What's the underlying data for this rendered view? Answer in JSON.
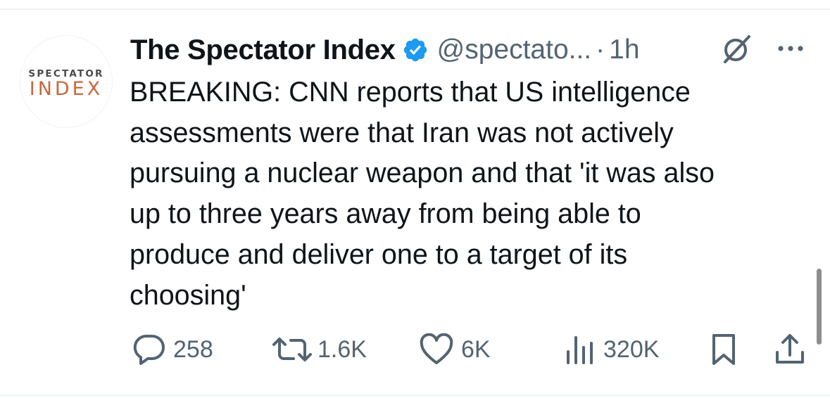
{
  "avatar": {
    "line1": "SPECTATOR",
    "line2": "INDEX"
  },
  "header": {
    "display_name": "The Spectator Index",
    "handle": "@spectato...",
    "separator": "·",
    "time": "1h"
  },
  "tweet": {
    "text": "BREAKING: CNN reports that US intelligence\nassessments were that Iran was not actively\npursuing a nuclear weapon and that 'it was also\nup to three years away from being able to\nproduce and deliver one to a target of its\nchoosing'"
  },
  "actions": {
    "replies": "258",
    "reposts": "1.6K",
    "likes": "6K",
    "views": "320K"
  },
  "icons": {
    "verified": "verified-badge-icon",
    "grok": "grok-icon",
    "more": "more-icon",
    "reply": "reply-icon",
    "repost": "repost-icon",
    "like": "heart-icon",
    "views": "views-chart-icon",
    "bookmark": "bookmark-icon",
    "share": "share-icon"
  },
  "colors": {
    "verified_blue": "#1d9bf0",
    "text": "#0f1419",
    "secondary": "#536471",
    "avatar_accent": "#c9663d"
  }
}
